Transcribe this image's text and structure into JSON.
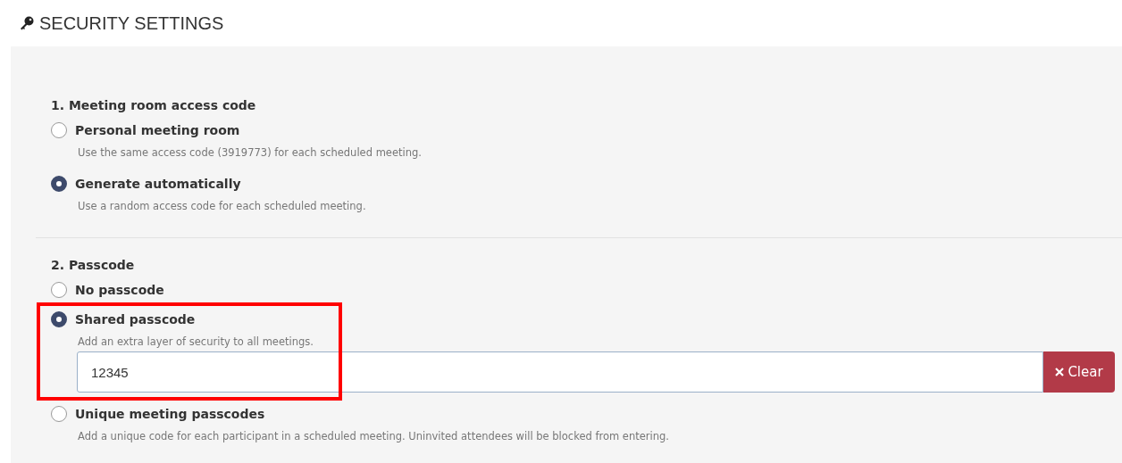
{
  "header": {
    "title": "SECURITY SETTINGS"
  },
  "sections": [
    {
      "heading": "1. Meeting room access code",
      "options": [
        {
          "label": "Personal meeting room",
          "description": "Use the same access code (3919773) for each scheduled meeting.",
          "selected": false,
          "highlighted": false
        },
        {
          "label": "Generate automatically",
          "description": "Use a random access code for each scheduled meeting.",
          "selected": true,
          "highlighted": false
        }
      ]
    },
    {
      "heading": "2. Passcode",
      "options": [
        {
          "label": "No passcode",
          "selected": false,
          "highlighted": false
        },
        {
          "label": "Shared passcode",
          "description": "Add an extra layer of security to all meetings.",
          "selected": true,
          "highlighted": true,
          "field": {
            "value": "12345",
            "button": "Clear"
          }
        },
        {
          "label": "Unique meeting passcodes",
          "description": "Add a unique code for each participant in a scheduled meeting. Uninvited attendees will be blocked from entering.",
          "selected": false,
          "highlighted": false
        }
      ]
    }
  ]
}
